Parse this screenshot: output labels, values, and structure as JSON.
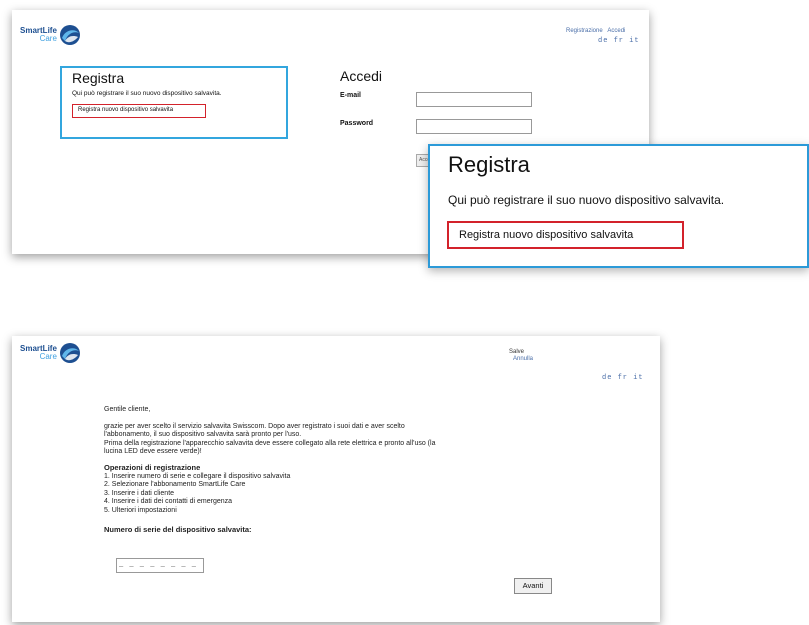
{
  "screen1": {
    "logo": {
      "line1": "SmartLife",
      "line2": "Care"
    },
    "top_links": [
      "Registrazione",
      "Accedi"
    ],
    "languages": [
      "de",
      "fr",
      "it"
    ],
    "register": {
      "title": "Registra",
      "description": "Qui può registrare il suo nuovo dispositivo salvavita.",
      "link": "Registra nuovo dispositivo salvavita"
    },
    "login": {
      "title": "Accedi",
      "email_label": "E-mail",
      "password_label": "Password",
      "button": "Accedi"
    }
  },
  "zoom": {
    "title": "Registra",
    "description": "Qui può registrare il suo nuovo dispositivo salvavita.",
    "link": "Registra nuovo dispositivo salvavita"
  },
  "screen2": {
    "logo": {
      "line1": "SmartLife",
      "line2": "Care"
    },
    "top_links": [
      "Salve",
      "Annulla"
    ],
    "languages": [
      "de",
      "fr",
      "it"
    ],
    "greeting": "Gentile cliente,",
    "intro_lines": [
      "grazie per aver scelto il servizio salvavita Swisscom. Dopo aver registrato i suoi dati e aver scelto",
      "l'abbonamento, il suo dispositivo salvavita sarà pronto per l'uso.",
      "Prima della registrazione l'apparecchio salvavita deve essere collegato alla rete elettrica e pronto all'uso (la",
      "lucina LED deve essere verde)!"
    ],
    "steps_title": "Operazioni di registrazione",
    "steps": [
      "1. Inserire numero di serie e collegare il dispositivo salvavita",
      "2. Selezionare l'abbonamento SmartLife Care",
      "3. Inserire i dati cliente",
      "4. Inserire i dati dei contatti di emergenza",
      "5. Ulteriori impostazioni"
    ],
    "serial_label": "Numero di serie del dispositivo salvavita:",
    "serial_value": "_ _ _ _ _ _ _ _",
    "next_button": "Avanti"
  }
}
